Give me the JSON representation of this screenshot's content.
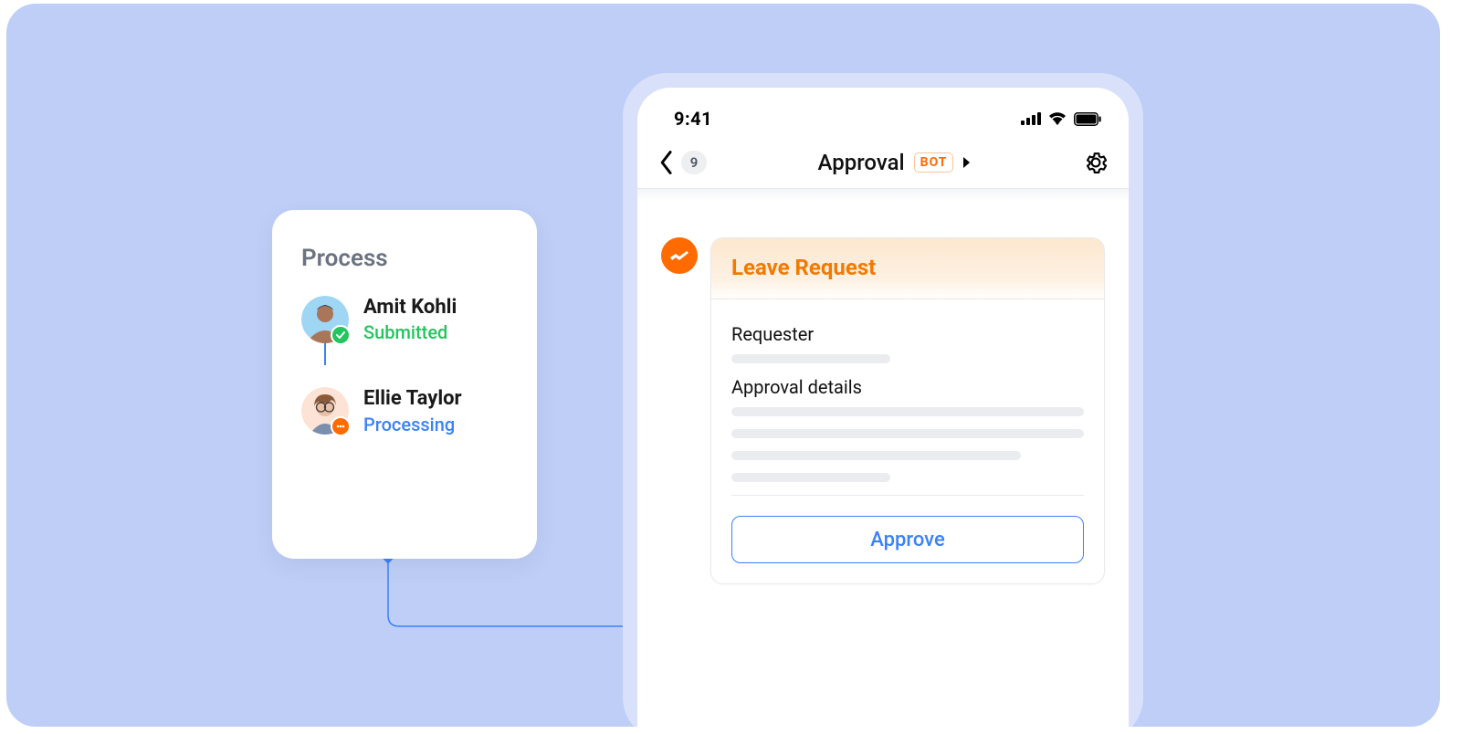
{
  "process": {
    "title": "Process",
    "people": [
      {
        "name": "Amit Kohli",
        "status": "Submitted",
        "status_kind": "submitted"
      },
      {
        "name": "Ellie Taylor",
        "status": "Processing",
        "status_kind": "processing"
      }
    ]
  },
  "phone": {
    "status_bar": {
      "time": "9:41"
    },
    "nav": {
      "count": "9",
      "title": "Approval",
      "bot_label": "BOT"
    },
    "card": {
      "title": "Leave Request",
      "requester_label": "Requester",
      "approval_details_label": "Approval details",
      "approve_button": "Approve"
    }
  }
}
